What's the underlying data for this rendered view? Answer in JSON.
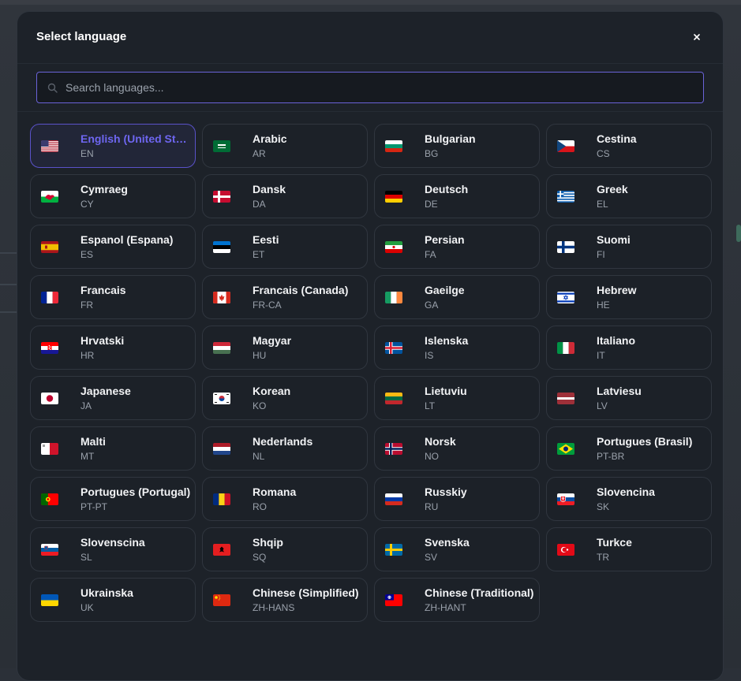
{
  "modal": {
    "title": "Select language",
    "close_label": "×",
    "search_placeholder": "Search languages..."
  },
  "selected_code": "EN",
  "colors": {
    "accent": "#6e66f0",
    "selected_border": "#5a52c9",
    "background": "#1d2229"
  },
  "languages": [
    {
      "name": "English (United States)",
      "code": "EN",
      "flag": "us-flag-icon",
      "selected": true
    },
    {
      "name": "Arabic",
      "code": "AR",
      "flag": "saudi-arabia-flag-icon"
    },
    {
      "name": "Bulgarian",
      "code": "BG",
      "flag": "bulgaria-flag-icon"
    },
    {
      "name": "Cestina",
      "code": "CS",
      "flag": "czech-flag-icon"
    },
    {
      "name": "Cymraeg",
      "code": "CY",
      "flag": "wales-flag-icon"
    },
    {
      "name": "Dansk",
      "code": "DA",
      "flag": "denmark-flag-icon"
    },
    {
      "name": "Deutsch",
      "code": "DE",
      "flag": "germany-flag-icon"
    },
    {
      "name": "Greek",
      "code": "EL",
      "flag": "greece-flag-icon"
    },
    {
      "name": "Espanol (Espana)",
      "code": "ES",
      "flag": "spain-flag-icon"
    },
    {
      "name": "Eesti",
      "code": "ET",
      "flag": "estonia-flag-icon"
    },
    {
      "name": "Persian",
      "code": "FA",
      "flag": "iran-flag-icon"
    },
    {
      "name": "Suomi",
      "code": "FI",
      "flag": "finland-flag-icon"
    },
    {
      "name": "Francais",
      "code": "FR",
      "flag": "france-flag-icon"
    },
    {
      "name": "Francais (Canada)",
      "code": "FR-CA",
      "flag": "canada-flag-icon"
    },
    {
      "name": "Gaeilge",
      "code": "GA",
      "flag": "ireland-flag-icon"
    },
    {
      "name": "Hebrew",
      "code": "HE",
      "flag": "israel-flag-icon"
    },
    {
      "name": "Hrvatski",
      "code": "HR",
      "flag": "croatia-flag-icon"
    },
    {
      "name": "Magyar",
      "code": "HU",
      "flag": "hungary-flag-icon"
    },
    {
      "name": "Islenska",
      "code": "IS",
      "flag": "iceland-flag-icon"
    },
    {
      "name": "Italiano",
      "code": "IT",
      "flag": "italy-flag-icon"
    },
    {
      "name": "Japanese",
      "code": "JA",
      "flag": "japan-flag-icon"
    },
    {
      "name": "Korean",
      "code": "KO",
      "flag": "south-korea-flag-icon"
    },
    {
      "name": "Lietuviu",
      "code": "LT",
      "flag": "lithuania-flag-icon"
    },
    {
      "name": "Latviesu",
      "code": "LV",
      "flag": "latvia-flag-icon"
    },
    {
      "name": "Malti",
      "code": "MT",
      "flag": "malta-flag-icon"
    },
    {
      "name": "Nederlands",
      "code": "NL",
      "flag": "netherlands-flag-icon"
    },
    {
      "name": "Norsk",
      "code": "NO",
      "flag": "norway-flag-icon"
    },
    {
      "name": "Portugues (Brasil)",
      "code": "PT-BR",
      "flag": "brazil-flag-icon"
    },
    {
      "name": "Portugues (Portugal)",
      "code": "PT-PT",
      "flag": "portugal-flag-icon"
    },
    {
      "name": "Romana",
      "code": "RO",
      "flag": "romania-flag-icon"
    },
    {
      "name": "Russkiy",
      "code": "RU",
      "flag": "russia-flag-icon"
    },
    {
      "name": "Slovencina",
      "code": "SK",
      "flag": "slovakia-flag-icon"
    },
    {
      "name": "Slovenscina",
      "code": "SL",
      "flag": "slovenia-flag-icon"
    },
    {
      "name": "Shqip",
      "code": "SQ",
      "flag": "albania-flag-icon"
    },
    {
      "name": "Svenska",
      "code": "SV",
      "flag": "sweden-flag-icon"
    },
    {
      "name": "Turkce",
      "code": "TR",
      "flag": "turkey-flag-icon"
    },
    {
      "name": "Ukrainska",
      "code": "UK",
      "flag": "ukraine-flag-icon"
    },
    {
      "name": "Chinese (Simplified)",
      "code": "ZH-HANS",
      "flag": "china-flag-icon"
    },
    {
      "name": "Chinese (Traditional)",
      "code": "ZH-HANT",
      "flag": "taiwan-flag-icon"
    }
  ]
}
